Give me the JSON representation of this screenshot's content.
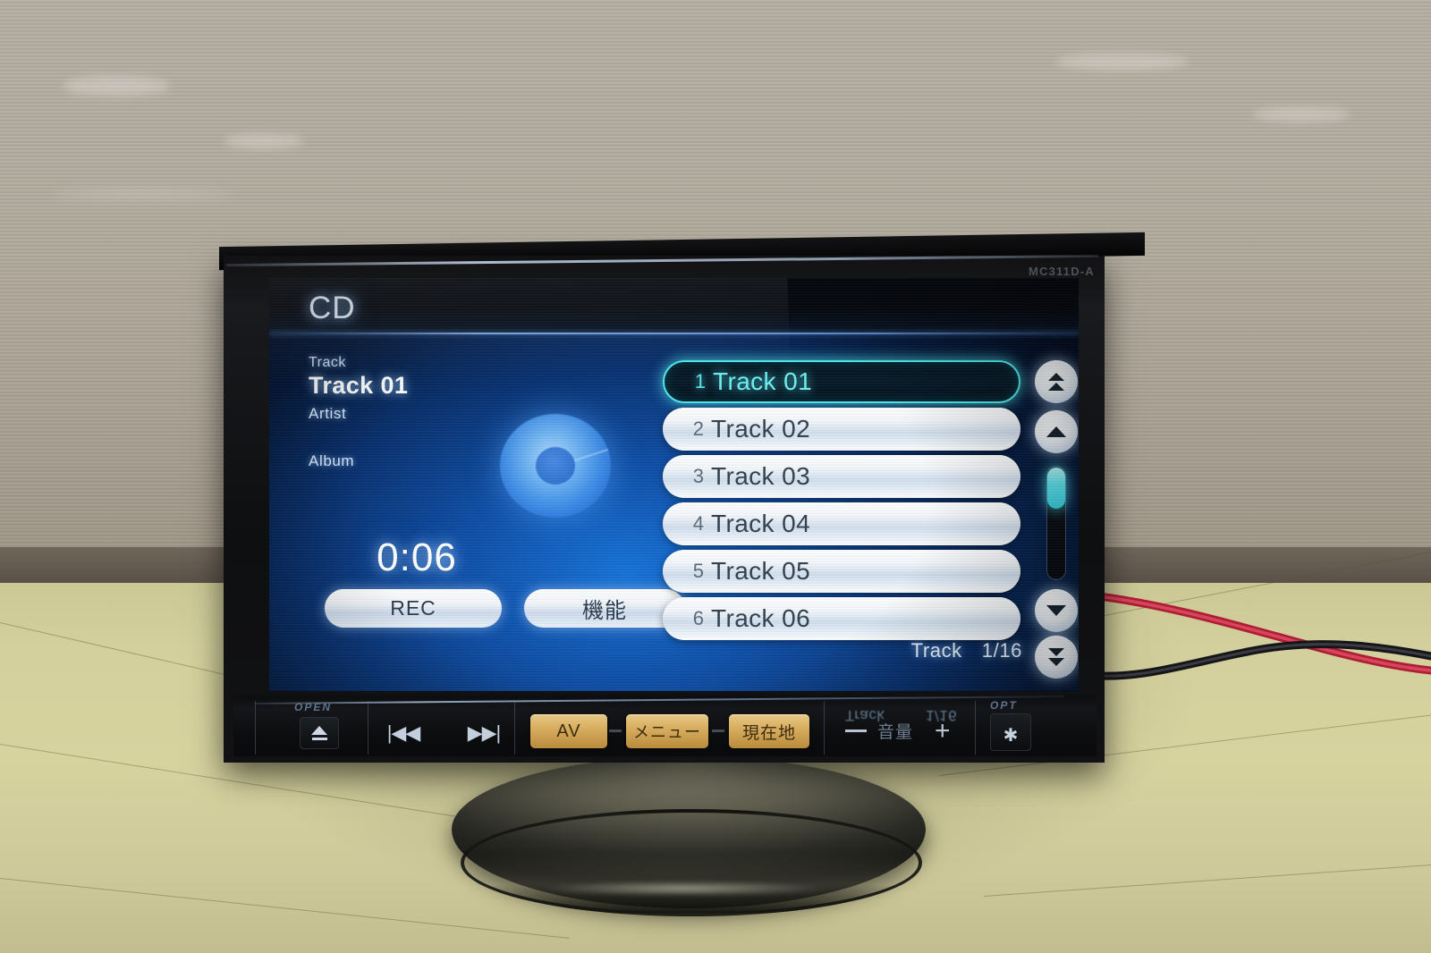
{
  "device": {
    "model_label": "MC311D-A"
  },
  "screen": {
    "header": {
      "title": "CD"
    },
    "now_playing": {
      "track_label": "Track",
      "track_value": "Track 01",
      "artist_label": "Artist",
      "album_label": "Album",
      "elapsed_time": "0:06"
    },
    "buttons": {
      "rec": "REC",
      "function": "機能"
    },
    "track_list": [
      {
        "num": "1",
        "name": "Track 01",
        "selected": true
      },
      {
        "num": "2",
        "name": "Track 02",
        "selected": false
      },
      {
        "num": "3",
        "name": "Track 03",
        "selected": false
      },
      {
        "num": "4",
        "name": "Track 04",
        "selected": false
      },
      {
        "num": "5",
        "name": "Track 05",
        "selected": false
      },
      {
        "num": "6",
        "name": "Track 06",
        "selected": false
      }
    ],
    "counter": {
      "label": "Track",
      "value": "1/16"
    },
    "scroll": {
      "page_up": "page-up",
      "line_up": "line-up",
      "line_down": "line-down",
      "page_down": "page-down"
    },
    "colors": {
      "accent_cyan": "#4fe8ea",
      "background_blue": "#0e4fa8",
      "header_dark": "#05080f"
    }
  },
  "control_bar": {
    "open_label": "OPEN",
    "opt_label": "OPT",
    "prev_glyph": "|◀◀",
    "next_glyph": "▶▶|",
    "av": "AV",
    "menu": "メニュー",
    "current_location": "現在地",
    "volume_label": "音量",
    "volume_minus": "−",
    "volume_plus": "+",
    "opt_glyph": "✱"
  },
  "ghost_reflection": {
    "track_label": "Track",
    "track_value": "1/16"
  }
}
